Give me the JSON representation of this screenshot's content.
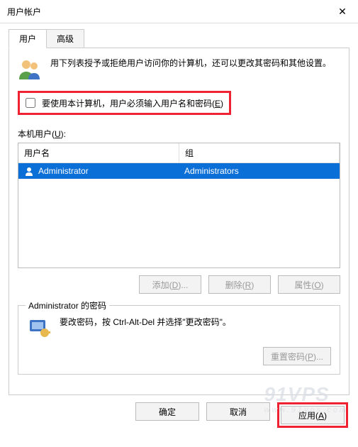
{
  "window": {
    "title": "用户帐户"
  },
  "tabs": {
    "user": "用户",
    "advanced": "高级"
  },
  "intro": "用下列表授予或拒绝用户访问你的计算机，还可以更改其密码和其他设置。",
  "checkbox": {
    "prefix": "要使用本计算机，用户必须输入用户名和密码(",
    "hotkey": "E",
    "suffix": ")"
  },
  "listLabel": {
    "prefix": "本机用户(",
    "hotkey": "U",
    "suffix": "):"
  },
  "columns": {
    "name": "用户名",
    "group": "组"
  },
  "rows": [
    {
      "name": "Administrator",
      "group": "Administrators"
    }
  ],
  "buttons": {
    "add": {
      "prefix": "添加(",
      "hotkey": "D",
      "suffix": ")..."
    },
    "remove": {
      "prefix": "删除(",
      "hotkey": "R",
      "suffix": ")"
    },
    "props": {
      "prefix": "属性(",
      "hotkey": "O",
      "suffix": ")"
    },
    "reset": {
      "prefix": "重置密码(",
      "hotkey": "P",
      "suffix": ")..."
    },
    "ok": "确定",
    "cancel": "取消",
    "apply": {
      "prefix": "应用(",
      "hotkey": "A",
      "suffix": ")"
    }
  },
  "groupbox": {
    "legend": "Administrator 的密码",
    "text": "要改密码，按 Ctrl-Alt-Del 并选择\"更改密码\"。"
  },
  "watermark": {
    "big": "91VPS",
    "small": "www.91vps.com"
  }
}
